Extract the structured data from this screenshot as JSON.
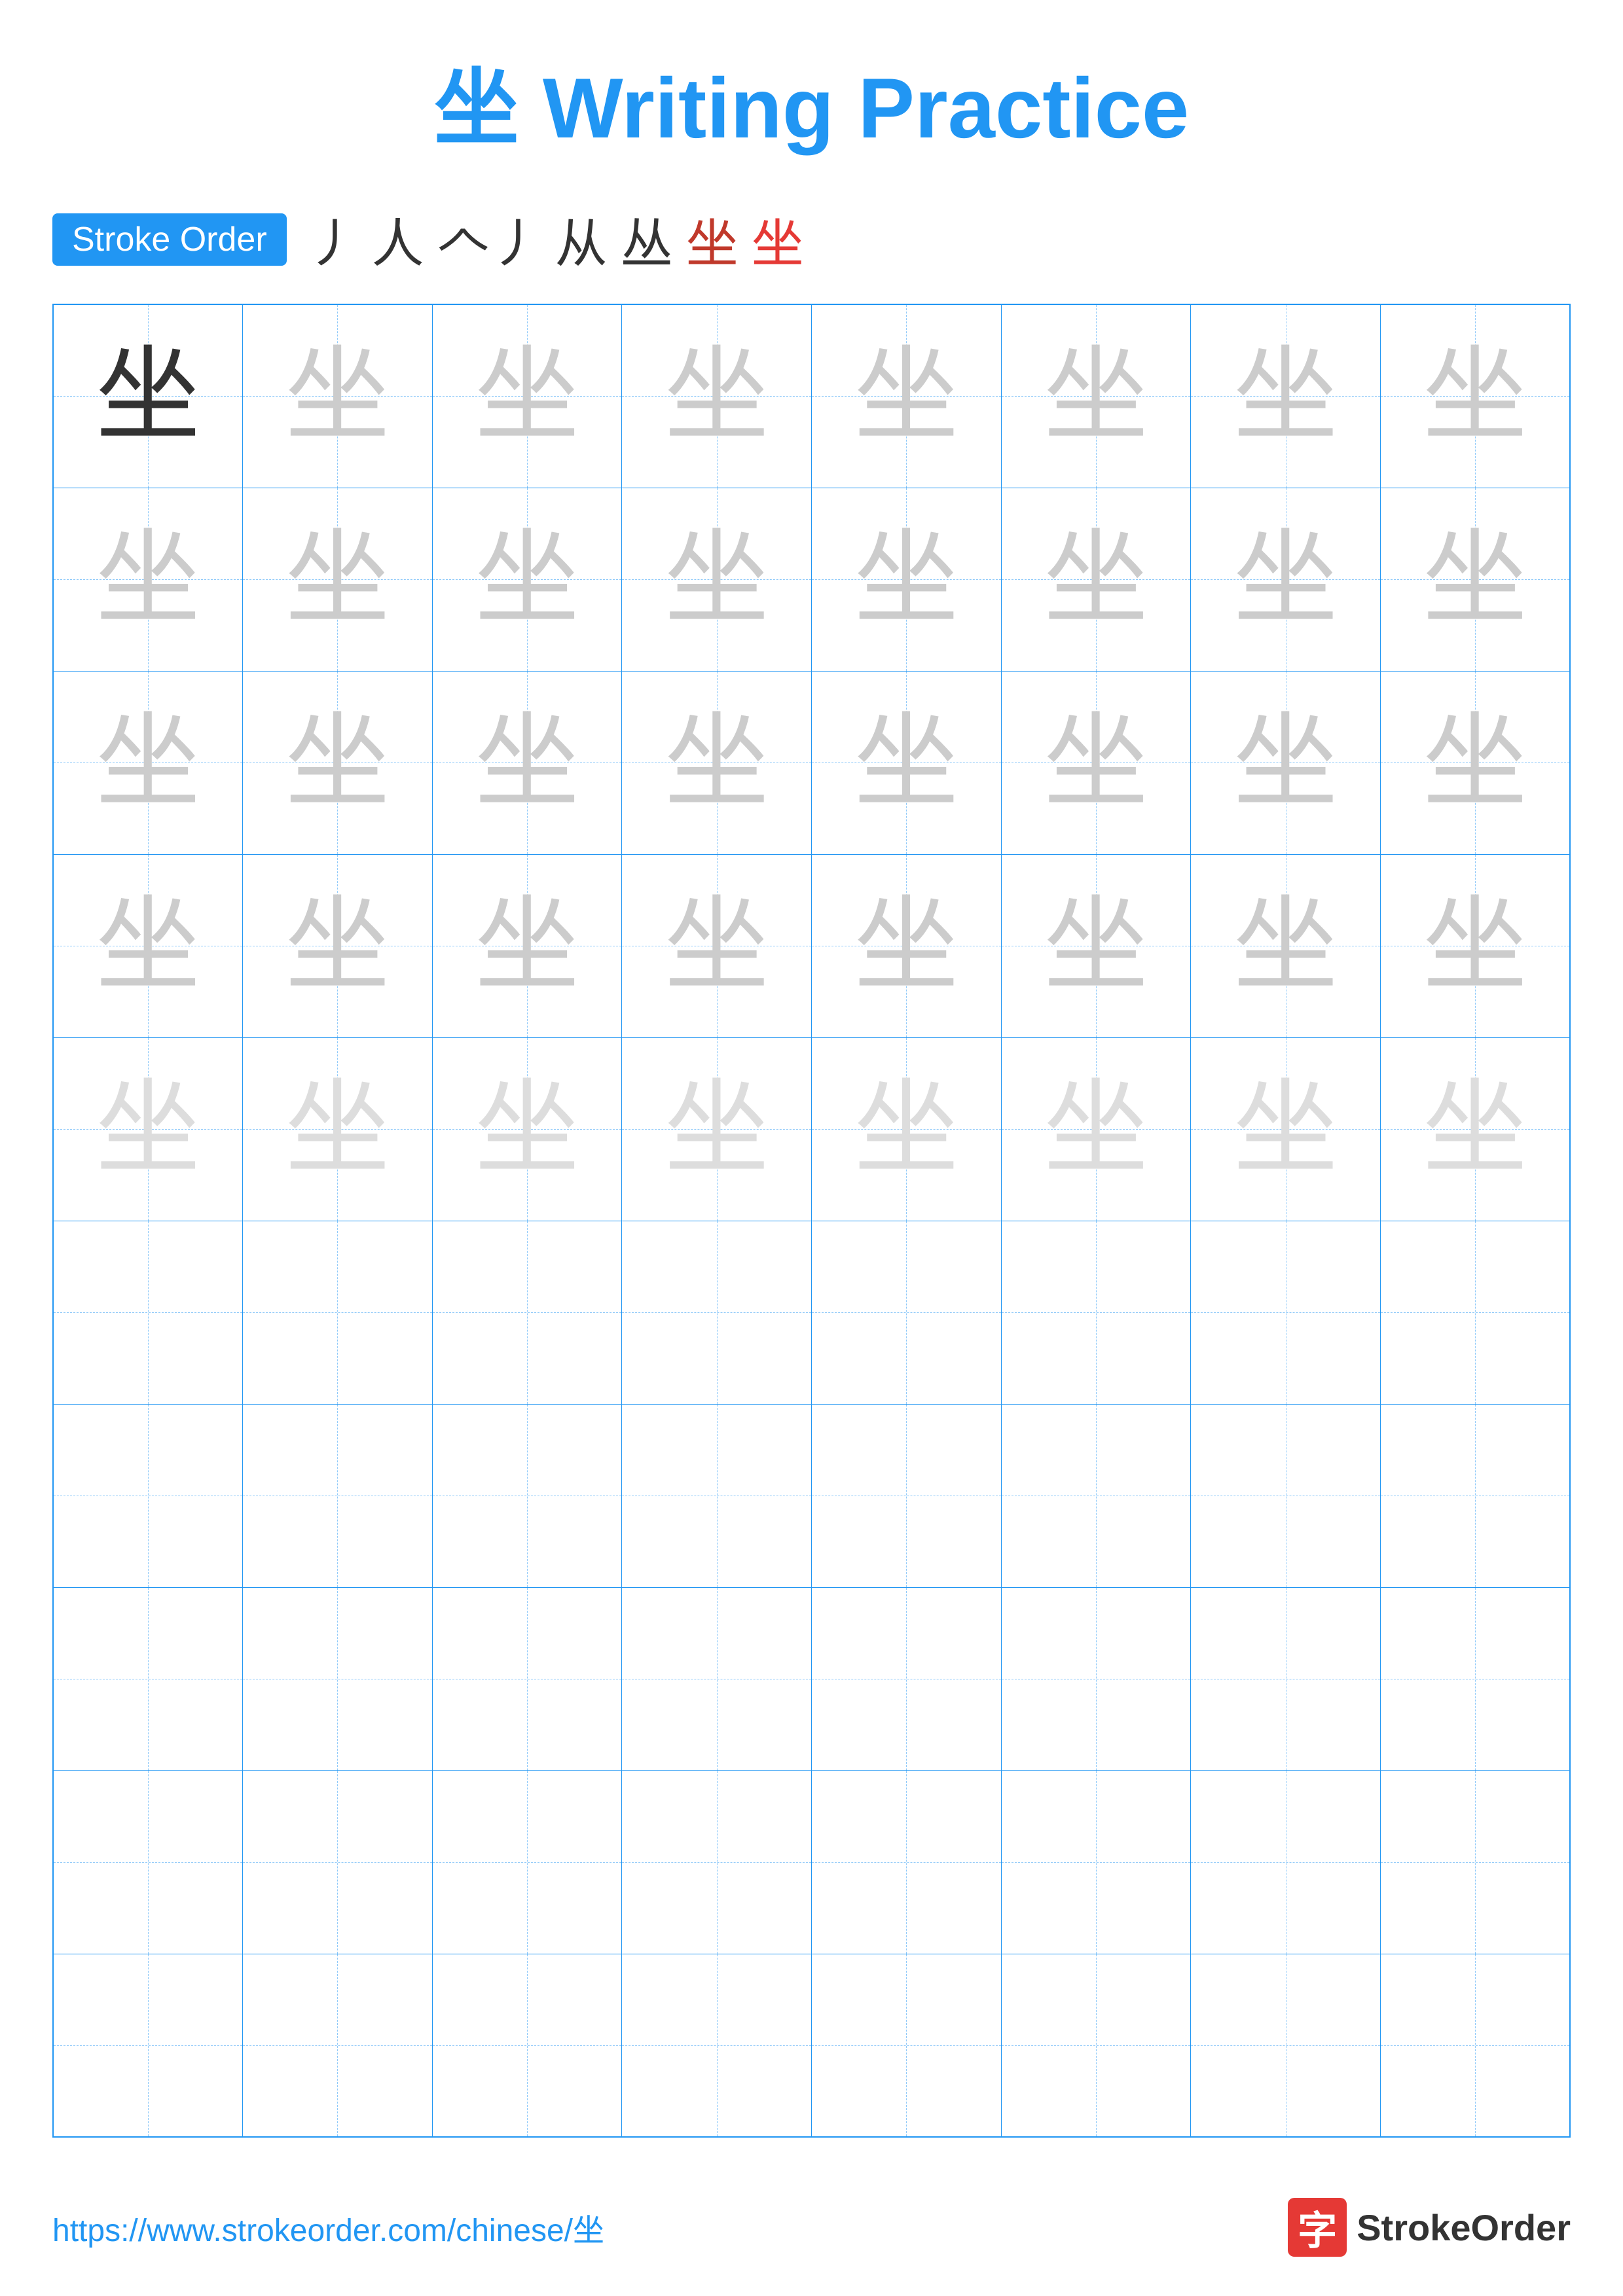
{
  "title": {
    "chinese": "坐",
    "english": "Writing Practice"
  },
  "stroke_order": {
    "badge_label": "Stroke Order",
    "strokes": [
      "丿",
      "人",
      "人丿",
      "从",
      "丛",
      "坐̣",
      "坐"
    ],
    "stroke_sequence": "丿  人  人丿  从  丛  坐*  坐"
  },
  "character": "坐",
  "grid": {
    "cols": 8,
    "practice_rows": 10,
    "char_color_row1_col1": "dark",
    "char_color_rest": "light"
  },
  "footer": {
    "url": "https://www.strokeorder.com/chinese/坐",
    "brand_logo_char": "字",
    "brand_name": "StrokeOrder"
  }
}
